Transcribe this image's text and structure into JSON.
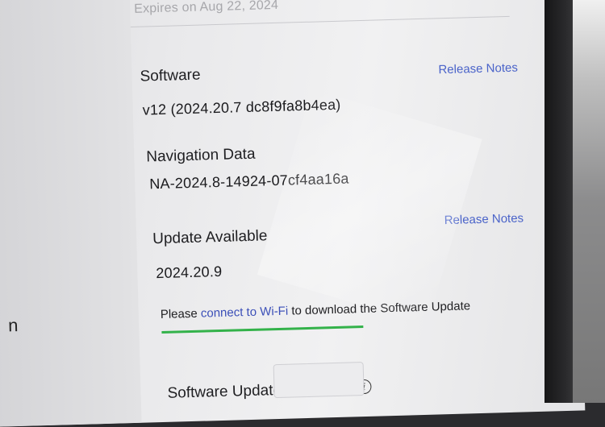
{
  "header": {
    "expires_text": "Expires on Aug 22, 2024"
  },
  "left_panel": {
    "partial_text": "n"
  },
  "software": {
    "label": "Software",
    "version": "v12 (2024.20.7 dc8f9fa8b4ea)",
    "release_notes_label": "Release Notes"
  },
  "navigation": {
    "label": "Navigation Data",
    "version": "NA-2024.8-14924-07cf4aa16a"
  },
  "update": {
    "label": "Update Available",
    "version": "2024.20.9",
    "release_notes_label": "Release Notes",
    "message_prefix": "Please ",
    "message_link": "connect to Wi-Fi",
    "message_suffix": " to download the Software Update"
  },
  "preference": {
    "label": "Software Update Preference",
    "info_icon": "i"
  },
  "colors": {
    "link": "#4a63c9",
    "progress": "#33b24a"
  }
}
